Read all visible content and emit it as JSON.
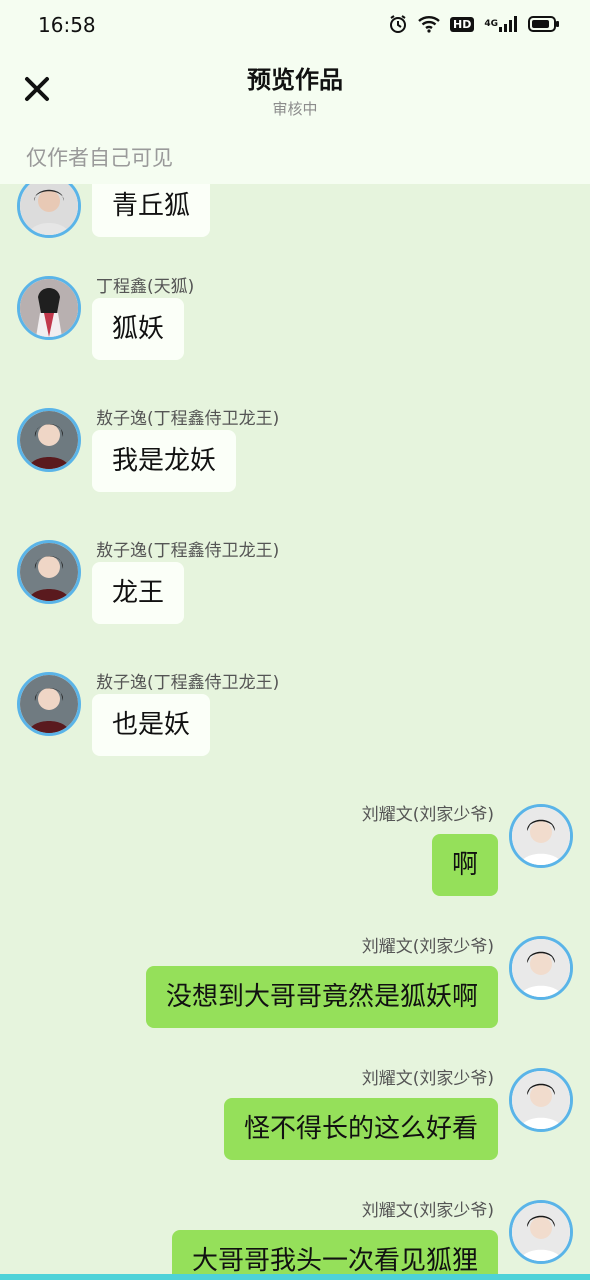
{
  "status_bar": {
    "time": "16:58",
    "icons": [
      "alarm-icon",
      "wifi-icon",
      "hd-icon",
      "signal-4g-icon",
      "battery-icon"
    ],
    "hd_label": "HD",
    "network_label": "4G"
  },
  "header": {
    "title": "预览作品",
    "subtitle": "审核中",
    "close_icon": "close-icon"
  },
  "privacy_notice": "仅作者自己可见",
  "messages": [
    {
      "side": "left",
      "name": "",
      "text": "青丘狐"
    },
    {
      "side": "left",
      "name": "丁程鑫(天狐)",
      "text": "狐妖"
    },
    {
      "side": "left",
      "name": "敖子逸(丁程鑫侍卫龙王)",
      "text": "我是龙妖"
    },
    {
      "side": "left",
      "name": "敖子逸(丁程鑫侍卫龙王)",
      "text": "龙王"
    },
    {
      "side": "left",
      "name": "敖子逸(丁程鑫侍卫龙王)",
      "text": "也是妖"
    },
    {
      "side": "right",
      "name": "刘耀文(刘家少爷)",
      "text": "啊"
    },
    {
      "side": "right",
      "name": "刘耀文(刘家少爷)",
      "text": "没想到大哥哥竟然是狐妖啊"
    },
    {
      "side": "right",
      "name": "刘耀文(刘家少爷)",
      "text": "怪不得长的这么好看"
    },
    {
      "side": "right",
      "name": "刘耀文(刘家少爷)",
      "text": "大哥哥我头一次看见狐狸"
    }
  ],
  "colors": {
    "background": "#e6f4dd",
    "header_bg": "#f5fdf1",
    "left_bubble": "#fbfff8",
    "right_bubble": "#95e05a",
    "avatar_ring": "#5ab4e8",
    "bottom_strip": "#4ed2d8"
  }
}
